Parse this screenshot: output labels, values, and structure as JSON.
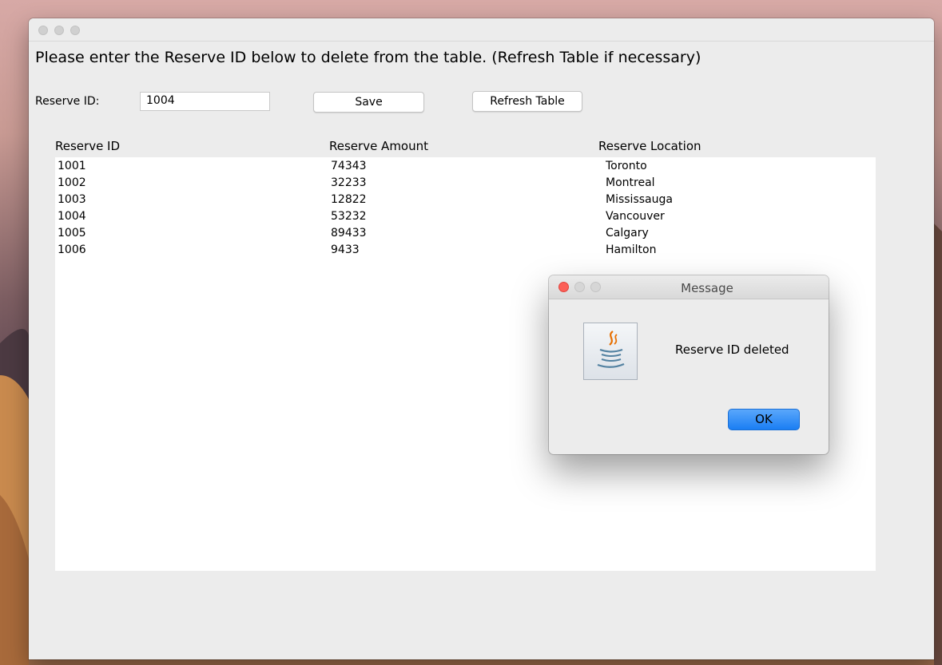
{
  "main_window": {
    "instruction": "Please enter the Reserve ID below to delete from the table. (Refresh Table if necessary)",
    "reserve_id_label": "Reserve ID:",
    "reserve_id_value": "1004",
    "save_label": "Save",
    "refresh_label": "Refresh Table"
  },
  "table": {
    "headers": [
      "Reserve ID",
      "Reserve Amount",
      "Reserve Location"
    ],
    "rows": [
      [
        "1001",
        "74343",
        "Toronto"
      ],
      [
        "1002",
        "32233",
        "Montreal"
      ],
      [
        "1003",
        "12822",
        "Mississauga"
      ],
      [
        "1004",
        "53232",
        "Vancouver"
      ],
      [
        "1005",
        "89433",
        "Calgary"
      ],
      [
        "1006",
        "9433",
        "Hamilton"
      ]
    ]
  },
  "dialog": {
    "title": "Message",
    "message": "Reserve ID deleted",
    "ok_label": "OK",
    "icon": "java-icon"
  },
  "colors": {
    "close": "#fc5f57",
    "inactive_light": "#d0d0d0",
    "ok_button": "#1a7ef3"
  }
}
